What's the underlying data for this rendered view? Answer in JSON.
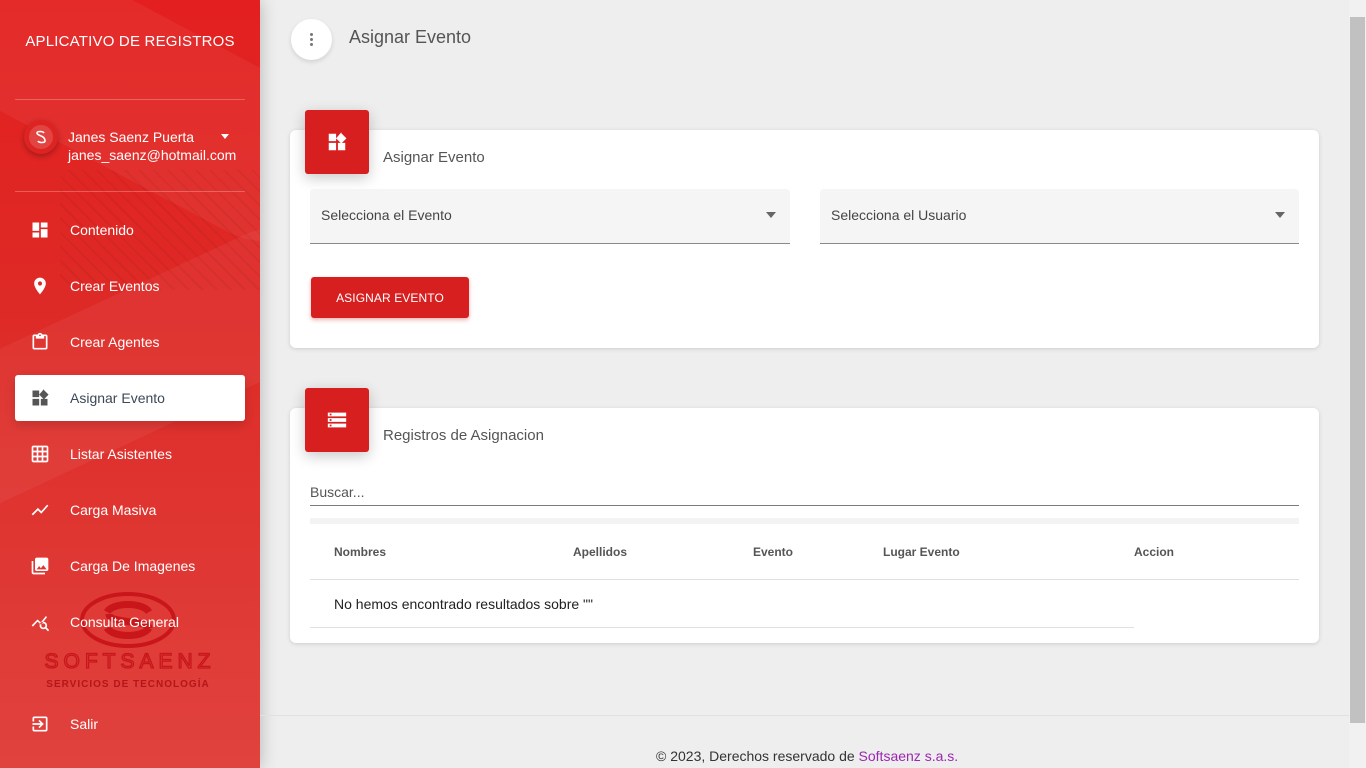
{
  "app": {
    "brand": "APLICATIVO DE REGISTROS"
  },
  "user": {
    "name": "Janes Saenz Puerta",
    "email": "janes_saenz@hotmail.com"
  },
  "sidebar": {
    "items": [
      {
        "label": "Contenido",
        "icon": "dashboard-icon"
      },
      {
        "label": "Crear Eventos",
        "icon": "location-pin-icon"
      },
      {
        "label": "Crear Agentes",
        "icon": "clipboard-icon"
      },
      {
        "label": "Asignar Evento",
        "icon": "widgets-icon",
        "active": true
      },
      {
        "label": "Listar Asistentes",
        "icon": "grid-icon"
      },
      {
        "label": "Carga Masiva",
        "icon": "trending-line-icon"
      },
      {
        "label": "Carga De Imagenes",
        "icon": "photo-library-icon"
      },
      {
        "label": "Consulta General",
        "icon": "query-stats-icon"
      },
      {
        "label": "Salir",
        "icon": "logout-icon"
      }
    ],
    "logo": {
      "name": "SOFTSAENZ",
      "tagline": "SERVICIOS DE TECNOLOGÍA"
    }
  },
  "header": {
    "title": "Asignar Evento"
  },
  "assign_card": {
    "title": "Asignar Evento",
    "event_select": "Selecciona el Evento",
    "user_select": "Selecciona el Usuario",
    "button": "ASIGNAR EVENTO"
  },
  "records_card": {
    "title": "Registros de Asignacion",
    "search_placeholder": "Buscar...",
    "columns": [
      "Nombres",
      "Apellidos",
      "Evento",
      "Lugar Evento",
      "Accion"
    ],
    "empty_message": "No hemos encontrado resultados sobre \"\""
  },
  "footer": {
    "text": "© 2023, Derechos reservado de ",
    "link": "Softsaenz s.a.s."
  },
  "colors": {
    "primary": "#d81f1f",
    "link": "#9c27b0"
  }
}
